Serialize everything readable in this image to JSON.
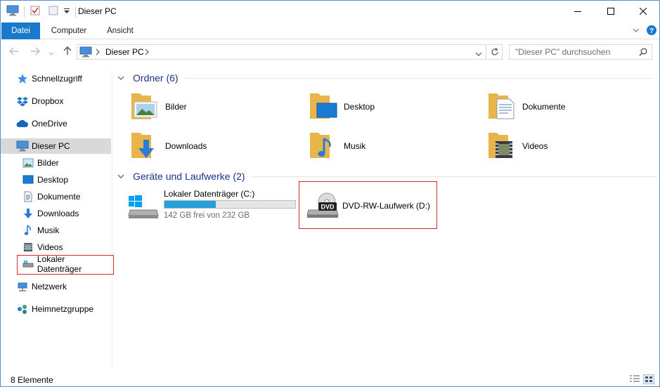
{
  "window": {
    "title": "Dieser PC",
    "controls": [
      "minimize",
      "maximize",
      "close"
    ]
  },
  "ribbon": {
    "tabs": [
      "Datei",
      "Computer",
      "Ansicht"
    ]
  },
  "address": {
    "path": "Dieser PC",
    "search_placeholder": "\"Dieser PC\" durchsuchen"
  },
  "sidebar": {
    "items": [
      {
        "label": "Schnellzugriff",
        "icon": "star-icon"
      },
      {
        "label": "Dropbox",
        "icon": "dropbox-icon"
      },
      {
        "label": "OneDrive",
        "icon": "cloud-icon"
      },
      {
        "label": "Dieser PC",
        "icon": "monitor-icon",
        "selected": true
      },
      {
        "label": "Bilder",
        "icon": "pictures-icon"
      },
      {
        "label": "Desktop",
        "icon": "desktop-icon"
      },
      {
        "label": "Dokumente",
        "icon": "document-icon"
      },
      {
        "label": "Downloads",
        "icon": "download-icon"
      },
      {
        "label": "Musik",
        "icon": "music-icon"
      },
      {
        "label": "Videos",
        "icon": "video-icon"
      },
      {
        "label": "Lokaler Datenträger",
        "icon": "drive-icon"
      },
      {
        "label": "Netzwerk",
        "icon": "network-icon"
      },
      {
        "label": "Heimnetzgruppe",
        "icon": "homegroup-icon"
      }
    ]
  },
  "folders": {
    "heading": "Ordner (6)",
    "items": [
      "Bilder",
      "Desktop",
      "Dokumente",
      "Downloads",
      "Musik",
      "Videos"
    ]
  },
  "drives": {
    "heading": "Geräte und Laufwerke (2)",
    "items": [
      {
        "name": "Lokaler Datenträger (C:)",
        "free": "142 GB frei von 232 GB",
        "used_fraction": 0.39
      },
      {
        "name": "DVD-RW-Laufwerk (D:)",
        "badge": "DVD"
      }
    ]
  },
  "statusbar": {
    "count": "8 Elemente"
  },
  "colors": {
    "accent": "#1979ca",
    "group_heading": "#1e3287",
    "highlight_box": "#d22d2d",
    "folder": "#f5c96a",
    "drive_bar": "#26a0da"
  }
}
